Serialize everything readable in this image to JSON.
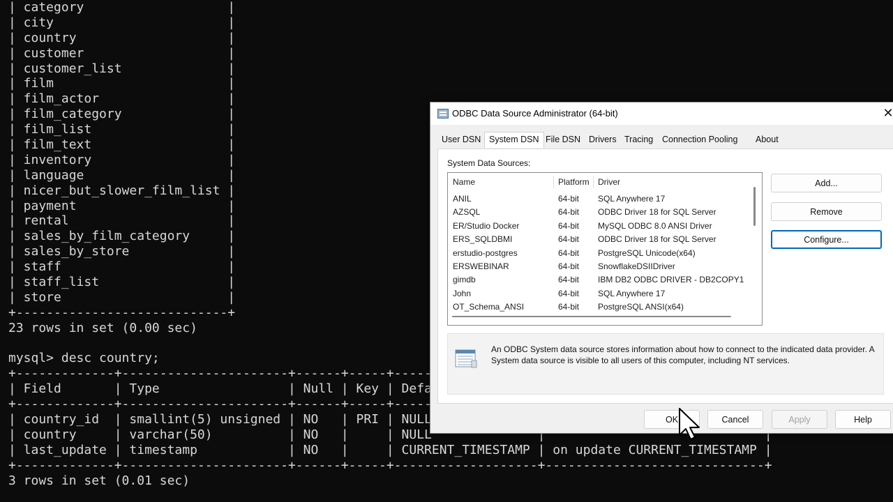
{
  "terminal": {
    "lines": [
      "| category                   |",
      "| city                       |",
      "| country                    |",
      "| customer                   |",
      "| customer_list              |",
      "| film                       |",
      "| film_actor                 |",
      "| film_category              |",
      "| film_list                  |",
      "| film_text                  |",
      "| inventory                  |",
      "| language                   |",
      "| nicer_but_slower_film_list |",
      "| payment                    |",
      "| rental                     |",
      "| sales_by_film_category     |",
      "| sales_by_store             |",
      "| staff                      |",
      "| staff_list                 |",
      "| store                      |",
      "+----------------------------+",
      "23 rows in set (0.00 sec)",
      "",
      "mysql> desc country;",
      "+-------------+----------------------+------+-----+-------------------+-----------------------------+",
      "| Field       | Type                 | Null | Key | Default           | Extra                       |",
      "+-------------+----------------------+------+-----+-------------------+-----------------------------+",
      "| country_id  | smallint(5) unsigned | NO   | PRI | NULL              |                             |",
      "| country     | varchar(50)          | NO   |     | NULL              |                             |",
      "| last_update | timestamp            | NO   |     | CURRENT_TIMESTAMP | on update CURRENT_TIMESTAMP |",
      "+-------------+----------------------+------+-----+-------------------+-----------------------------+",
      "3 rows in set (0.01 sec)"
    ]
  },
  "dialog": {
    "title": "ODBC Data Source Administrator (64-bit)",
    "close_glyph": "✕",
    "tabs": [
      "User DSN",
      "System DSN",
      "File DSN",
      "Drivers",
      "Tracing",
      "Connection Pooling",
      "About"
    ],
    "active_tab": "System DSN",
    "list_label": "System Data Sources:",
    "columns": [
      "Name",
      "Platform",
      "Driver"
    ],
    "rows": [
      {
        "name": "ANIL",
        "platform": "64-bit",
        "driver": "SQL Anywhere 17"
      },
      {
        "name": "AZSQL",
        "platform": "64-bit",
        "driver": "ODBC Driver 18 for SQL Server"
      },
      {
        "name": "ER/Studio Docker",
        "platform": "64-bit",
        "driver": "MySQL ODBC 8.0 ANSI Driver"
      },
      {
        "name": "ERS_SQLDBMI",
        "platform": "64-bit",
        "driver": "ODBC Driver 18 for SQL Server"
      },
      {
        "name": "erstudio-postgres",
        "platform": "64-bit",
        "driver": "PostgreSQL Unicode(x64)"
      },
      {
        "name": "ERSWEBINAR",
        "platform": "64-bit",
        "driver": "SnowflakeDSIIDriver"
      },
      {
        "name": "gimdb",
        "platform": "64-bit",
        "driver": "IBM DB2 ODBC DRIVER - DB2COPY1"
      },
      {
        "name": "John",
        "platform": "64-bit",
        "driver": "SQL Anywhere 17"
      },
      {
        "name": "OT_Schema_ANSI",
        "platform": "64-bit",
        "driver": "PostgreSQL ANSI(x64)"
      }
    ],
    "side_buttons": {
      "add": "Add...",
      "remove": "Remove",
      "configure": "Configure..."
    },
    "info_text": "An ODBC System data source stores information about how to connect to the indicated data provider. A System data source is visible to all users of this computer, including NT services.",
    "footer_buttons": {
      "ok": "OK",
      "cancel": "Cancel",
      "apply": "Apply",
      "help": "Help"
    }
  },
  "colors": {
    "terminal_bg": "#0c0c0c",
    "terminal_fg": "#d8d8d8",
    "dialog_bg": "#f0f0f0",
    "accent": "#0067c0"
  }
}
